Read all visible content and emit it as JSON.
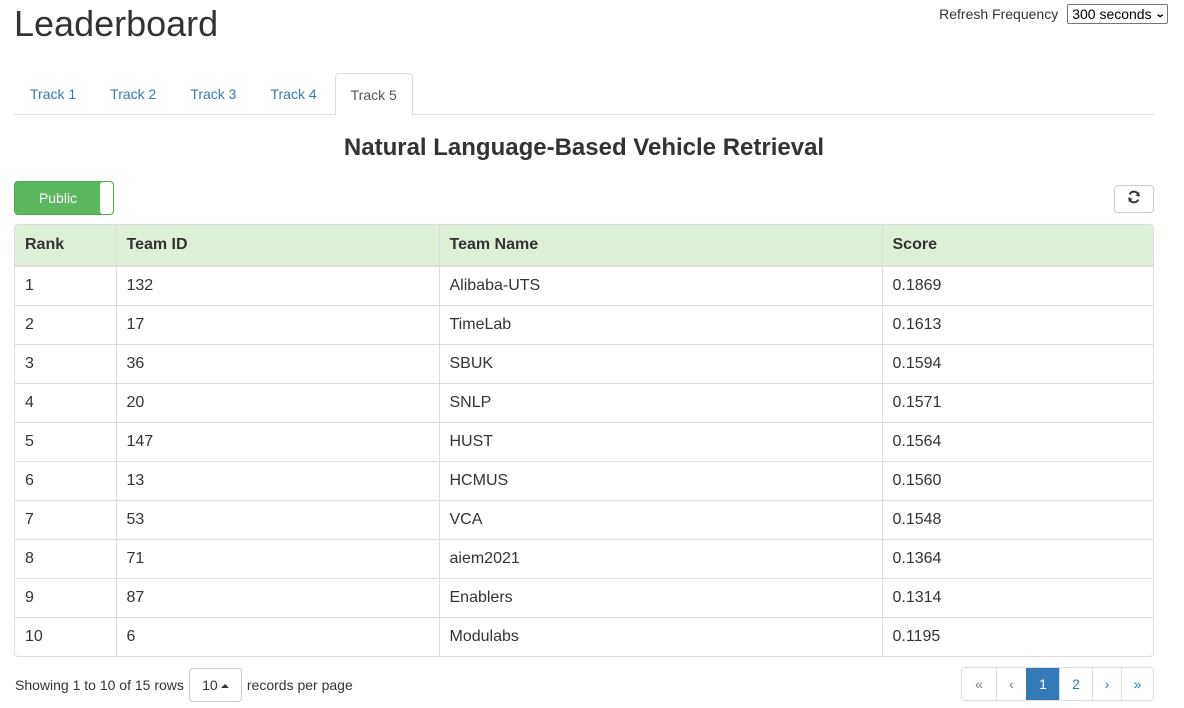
{
  "header": {
    "title": "Leaderboard",
    "refresh_label": "Refresh Frequency",
    "refresh_value": "300 seconds"
  },
  "tabs": [
    {
      "label": "Track 1",
      "active": false
    },
    {
      "label": "Track 2",
      "active": false
    },
    {
      "label": "Track 3",
      "active": false
    },
    {
      "label": "Track 4",
      "active": false
    },
    {
      "label": "Track 5",
      "active": true
    }
  ],
  "subtitle": "Natural Language-Based Vehicle Retrieval",
  "toggle": {
    "label": "Public",
    "state": "on",
    "color": "#5cb85c"
  },
  "refresh_button": {
    "icon": "refresh-icon"
  },
  "table": {
    "header_bg": "#dff0d8",
    "columns": [
      "Rank",
      "Team ID",
      "Team Name",
      "Score"
    ],
    "rows": [
      [
        "1",
        "132",
        "Alibaba-UTS",
        "0.1869"
      ],
      [
        "2",
        "17",
        "TimeLab",
        "0.1613"
      ],
      [
        "3",
        "36",
        "SBUK",
        "0.1594"
      ],
      [
        "4",
        "20",
        "SNLP",
        "0.1571"
      ],
      [
        "5",
        "147",
        "HUST",
        "0.1564"
      ],
      [
        "6",
        "13",
        "HCMUS",
        "0.1560"
      ],
      [
        "7",
        "53",
        "VCA",
        "0.1548"
      ],
      [
        "8",
        "71",
        "aiem2021",
        "0.1364"
      ],
      [
        "9",
        "87",
        "Enablers",
        "0.1314"
      ],
      [
        "10",
        "6",
        "Modulabs",
        "0.1195"
      ]
    ]
  },
  "footer": {
    "showing": "Showing 1 to 10 of 15 rows",
    "page_size": "10",
    "per_page_label": "records per page"
  },
  "pagination": {
    "first": "«",
    "prev": "‹",
    "pages": [
      "1",
      "2"
    ],
    "active_page": "1",
    "next": "›",
    "last": "»"
  }
}
